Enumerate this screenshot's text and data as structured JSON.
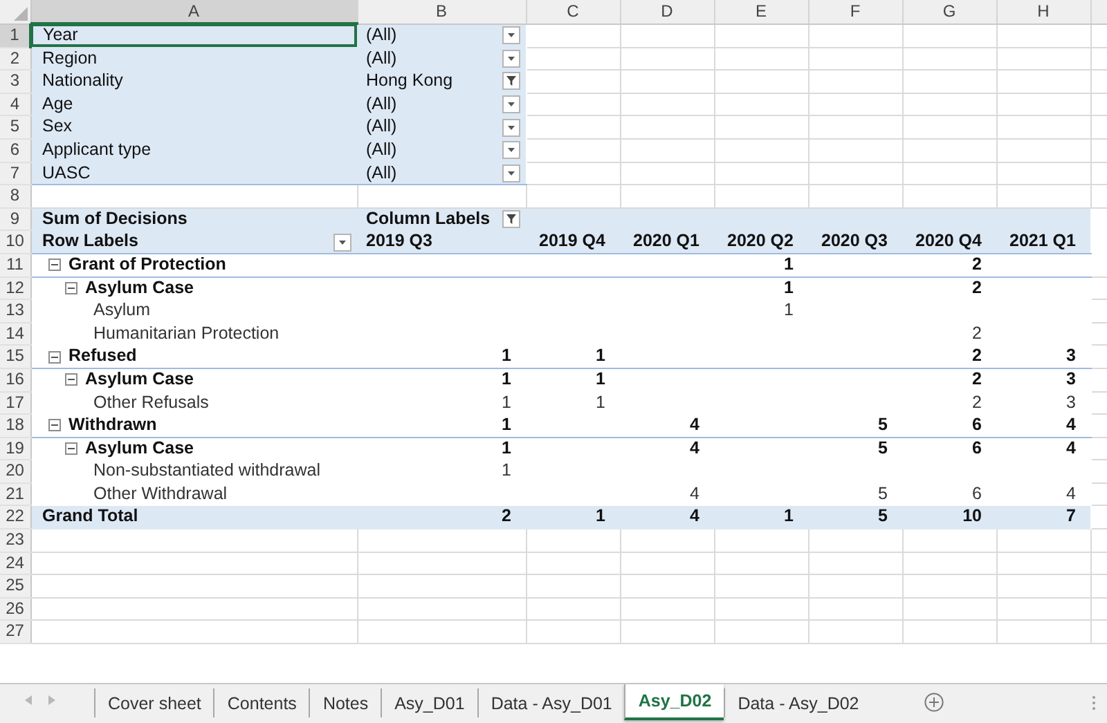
{
  "sheet": {
    "column_headers": [
      {
        "label": "A",
        "selected": true
      },
      {
        "label": "B",
        "selected": false
      },
      {
        "label": "C",
        "selected": false
      },
      {
        "label": "D",
        "selected": false
      },
      {
        "label": "E",
        "selected": false
      },
      {
        "label": "F",
        "selected": false
      },
      {
        "label": "G",
        "selected": false
      },
      {
        "label": "H",
        "selected": false
      }
    ],
    "row_numbers": [
      {
        "label": "1",
        "selected": true
      },
      {
        "label": "2",
        "selected": false
      },
      {
        "label": "3",
        "selected": false
      },
      {
        "label": "4",
        "selected": false
      },
      {
        "label": "5",
        "selected": false
      },
      {
        "label": "6",
        "selected": false
      },
      {
        "label": "7",
        "selected": false
      },
      {
        "label": "8",
        "selected": false
      },
      {
        "label": "9",
        "selected": false
      },
      {
        "label": "10",
        "selected": false
      },
      {
        "label": "11",
        "selected": false
      },
      {
        "label": "12",
        "selected": false
      },
      {
        "label": "13",
        "selected": false
      },
      {
        "label": "14",
        "selected": false
      },
      {
        "label": "15",
        "selected": false
      },
      {
        "label": "16",
        "selected": false
      },
      {
        "label": "17",
        "selected": false
      },
      {
        "label": "18",
        "selected": false
      },
      {
        "label": "19",
        "selected": false
      },
      {
        "label": "20",
        "selected": false
      },
      {
        "label": "21",
        "selected": false
      },
      {
        "label": "22",
        "selected": false
      },
      {
        "label": "23",
        "selected": false
      },
      {
        "label": "24",
        "selected": false
      },
      {
        "label": "25",
        "selected": false
      },
      {
        "label": "26",
        "selected": false
      },
      {
        "label": "27",
        "selected": false
      }
    ]
  },
  "pivot": {
    "filters": [
      {
        "label": "Year",
        "value": "(All)",
        "filtered": false
      },
      {
        "label": "Region",
        "value": "(All)",
        "filtered": false
      },
      {
        "label": "Nationality",
        "value": "Hong Kong",
        "filtered": true
      },
      {
        "label": "Age",
        "value": "(All)",
        "filtered": false
      },
      {
        "label": "Sex",
        "value": "(All)",
        "filtered": false
      },
      {
        "label": "Applicant type",
        "value": "(All)",
        "filtered": false
      },
      {
        "label": "UASC",
        "value": "(All)",
        "filtered": false
      }
    ],
    "value_field": "Sum of Decisions",
    "column_labels": {
      "label": "Column Labels",
      "filtered": true
    },
    "row_labels": {
      "label": "Row Labels",
      "filtered": false
    },
    "columns": [
      "2019 Q3",
      "2019 Q4",
      "2020 Q1",
      "2020 Q2",
      "2020 Q3",
      "2020 Q4",
      "2021 Q1"
    ],
    "rows": [
      {
        "label": "Grant of Protection",
        "expanded": true,
        "values": {
          "c4": "1",
          "c6": "2"
        },
        "children": [
          {
            "label": "Asylum Case",
            "expanded": true,
            "values": {
              "c4": "1",
              "c6": "2"
            },
            "children": [
              {
                "label": "Asylum",
                "values": {
                  "c4": "1"
                }
              },
              {
                "label": "Humanitarian Protection",
                "values": {
                  "c6": "2"
                }
              }
            ]
          }
        ]
      },
      {
        "label": "Refused",
        "expanded": true,
        "values": {
          "c1": "1",
          "c2": "1",
          "c6": "2",
          "c7": "3"
        },
        "children": [
          {
            "label": "Asylum Case",
            "expanded": true,
            "values": {
              "c1": "1",
              "c2": "1",
              "c6": "2",
              "c7": "3"
            },
            "children": [
              {
                "label": "Other Refusals",
                "values": {
                  "c1": "1",
                  "c2": "1",
                  "c6": "2",
                  "c7": "3"
                }
              }
            ]
          }
        ]
      },
      {
        "label": "Withdrawn",
        "expanded": true,
        "values": {
          "c1": "1",
          "c3": "4",
          "c5": "5",
          "c6": "6",
          "c7": "4"
        },
        "children": [
          {
            "label": "Asylum Case",
            "expanded": true,
            "values": {
              "c1": "1",
              "c3": "4",
              "c5": "5",
              "c6": "6",
              "c7": "4"
            },
            "children": [
              {
                "label": "Non-substantiated withdrawal",
                "values": {
                  "c1": "1"
                }
              },
              {
                "label": "Other Withdrawal",
                "values": {
                  "c3": "4",
                  "c5": "5",
                  "c6": "6",
                  "c7": "4"
                }
              }
            ]
          }
        ]
      }
    ],
    "grand_total": {
      "label": "Grand Total",
      "values": {
        "c1": "2",
        "c2": "1",
        "c3": "4",
        "c4": "1",
        "c5": "5",
        "c6": "10",
        "c7": "7"
      }
    }
  },
  "sheet_tabs": [
    {
      "label": "Cover sheet",
      "selected": false
    },
    {
      "label": "Contents",
      "selected": false
    },
    {
      "label": "Notes",
      "selected": false
    },
    {
      "label": "Asy_D01",
      "selected": false
    },
    {
      "label": "Data - Asy_D01",
      "selected": false
    },
    {
      "label": "Asy_D02",
      "selected": true
    },
    {
      "label": "Data - Asy_D02",
      "selected": false
    }
  ]
}
